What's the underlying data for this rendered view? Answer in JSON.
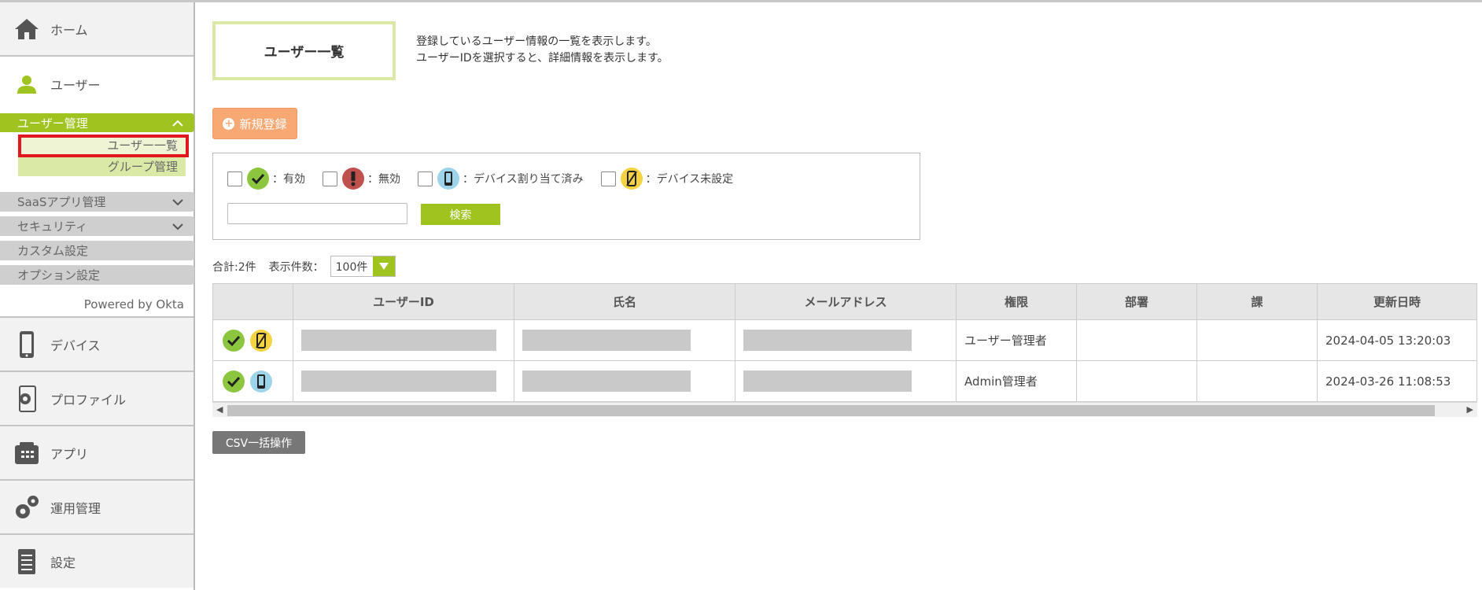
{
  "sidebar": {
    "home": "ホーム",
    "user": "ユーザー",
    "user_mgmt": "ユーザー管理",
    "user_list": "ユーザー一覧",
    "group_mgmt": "グループ管理",
    "saas": "SaaSアプリ管理",
    "security": "セキュリティ",
    "custom": "カスタム設定",
    "option": "オプション設定",
    "powered": "Powered by Okta",
    "device": "デバイス",
    "profile": "プロファイル",
    "app": "アプリ",
    "ops": "運用管理",
    "settings": "設定"
  },
  "header": {
    "title": "ユーザー一覧",
    "desc1": "登録しているユーザー情報の一覧を表示します。",
    "desc2": "ユーザーIDを選択すると、詳細情報を表示します。"
  },
  "toolbar": {
    "new_label": "新規登録"
  },
  "filter": {
    "valid": "：有効",
    "invalid": "：無効",
    "assigned": "：デバイス割り当て済み",
    "unset": "：デバイス未設定",
    "search_label": "検索"
  },
  "summary": {
    "total": "合計:2件",
    "per_page_label": "表示件数：",
    "per_page_value": "100件"
  },
  "table": {
    "headers": [
      "",
      "ユーザーID",
      "氏名",
      "メールアドレス",
      "権限",
      "部署",
      "課",
      "更新日時"
    ],
    "rows": [
      {
        "role": "ユーザー管理者",
        "updated": "2024-04-05 13:20:03"
      },
      {
        "role": "Admin管理者",
        "updated": "2024-03-26 11:08:53"
      }
    ]
  },
  "csv_label": "CSV一括操作",
  "colors": {
    "accent": "#9fc31f",
    "orange": "#f7a873",
    "highlight": "#e0191f"
  }
}
